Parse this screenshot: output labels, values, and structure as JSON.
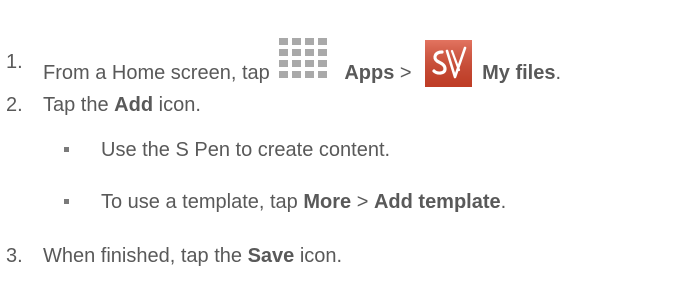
{
  "steps": [
    {
      "number": "1.",
      "prefix": "From a Home screen, tap",
      "apps_label": "Apps",
      "separator": ">",
      "my_files_label": "My files",
      "end": "."
    },
    {
      "number": "2.",
      "prefix": "Tap the",
      "bold": "Add",
      "suffix": "icon."
    },
    {
      "number": "3.",
      "prefix": "When finished, tap the",
      "bold": "Save",
      "suffix": "icon."
    }
  ],
  "bullets": [
    {
      "text": "Use the S Pen to create content."
    },
    {
      "prefix": "To use a template, tap",
      "more": "More",
      "separator": ">",
      "add_template": "Add template",
      "end": "."
    }
  ],
  "icons": {
    "apps": "apps-grid-icon",
    "my_files": "my-files-icon",
    "my_files_color": "#d9452b"
  }
}
